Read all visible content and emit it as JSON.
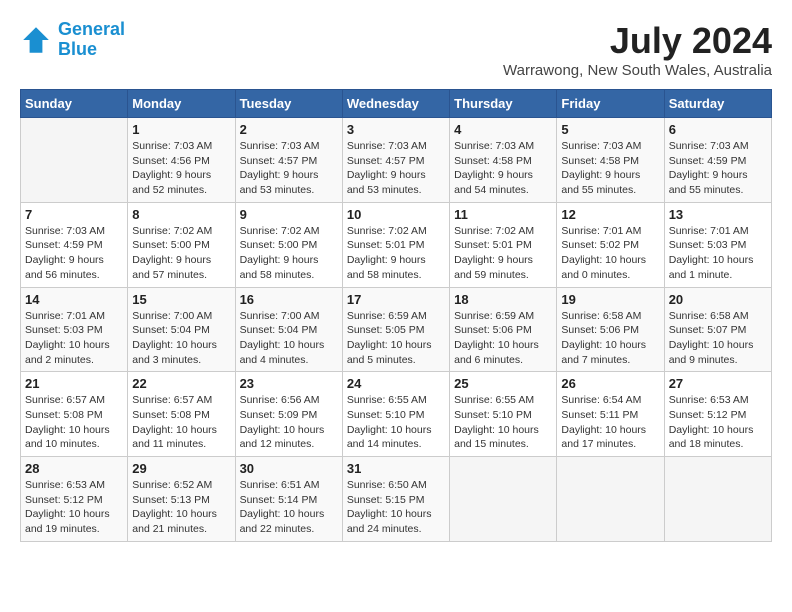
{
  "header": {
    "logo_line1": "General",
    "logo_line2": "Blue",
    "month_title": "July 2024",
    "location": "Warrawong, New South Wales, Australia"
  },
  "days_of_week": [
    "Sunday",
    "Monday",
    "Tuesday",
    "Wednesday",
    "Thursday",
    "Friday",
    "Saturday"
  ],
  "weeks": [
    [
      {
        "day": "",
        "info": ""
      },
      {
        "day": "1",
        "info": "Sunrise: 7:03 AM\nSunset: 4:56 PM\nDaylight: 9 hours\nand 52 minutes."
      },
      {
        "day": "2",
        "info": "Sunrise: 7:03 AM\nSunset: 4:57 PM\nDaylight: 9 hours\nand 53 minutes."
      },
      {
        "day": "3",
        "info": "Sunrise: 7:03 AM\nSunset: 4:57 PM\nDaylight: 9 hours\nand 53 minutes."
      },
      {
        "day": "4",
        "info": "Sunrise: 7:03 AM\nSunset: 4:58 PM\nDaylight: 9 hours\nand 54 minutes."
      },
      {
        "day": "5",
        "info": "Sunrise: 7:03 AM\nSunset: 4:58 PM\nDaylight: 9 hours\nand 55 minutes."
      },
      {
        "day": "6",
        "info": "Sunrise: 7:03 AM\nSunset: 4:59 PM\nDaylight: 9 hours\nand 55 minutes."
      }
    ],
    [
      {
        "day": "7",
        "info": "Sunrise: 7:03 AM\nSunset: 4:59 PM\nDaylight: 9 hours\nand 56 minutes."
      },
      {
        "day": "8",
        "info": "Sunrise: 7:02 AM\nSunset: 5:00 PM\nDaylight: 9 hours\nand 57 minutes."
      },
      {
        "day": "9",
        "info": "Sunrise: 7:02 AM\nSunset: 5:00 PM\nDaylight: 9 hours\nand 58 minutes."
      },
      {
        "day": "10",
        "info": "Sunrise: 7:02 AM\nSunset: 5:01 PM\nDaylight: 9 hours\nand 58 minutes."
      },
      {
        "day": "11",
        "info": "Sunrise: 7:02 AM\nSunset: 5:01 PM\nDaylight: 9 hours\nand 59 minutes."
      },
      {
        "day": "12",
        "info": "Sunrise: 7:01 AM\nSunset: 5:02 PM\nDaylight: 10 hours\nand 0 minutes."
      },
      {
        "day": "13",
        "info": "Sunrise: 7:01 AM\nSunset: 5:03 PM\nDaylight: 10 hours\nand 1 minute."
      }
    ],
    [
      {
        "day": "14",
        "info": "Sunrise: 7:01 AM\nSunset: 5:03 PM\nDaylight: 10 hours\nand 2 minutes."
      },
      {
        "day": "15",
        "info": "Sunrise: 7:00 AM\nSunset: 5:04 PM\nDaylight: 10 hours\nand 3 minutes."
      },
      {
        "day": "16",
        "info": "Sunrise: 7:00 AM\nSunset: 5:04 PM\nDaylight: 10 hours\nand 4 minutes."
      },
      {
        "day": "17",
        "info": "Sunrise: 6:59 AM\nSunset: 5:05 PM\nDaylight: 10 hours\nand 5 minutes."
      },
      {
        "day": "18",
        "info": "Sunrise: 6:59 AM\nSunset: 5:06 PM\nDaylight: 10 hours\nand 6 minutes."
      },
      {
        "day": "19",
        "info": "Sunrise: 6:58 AM\nSunset: 5:06 PM\nDaylight: 10 hours\nand 7 minutes."
      },
      {
        "day": "20",
        "info": "Sunrise: 6:58 AM\nSunset: 5:07 PM\nDaylight: 10 hours\nand 9 minutes."
      }
    ],
    [
      {
        "day": "21",
        "info": "Sunrise: 6:57 AM\nSunset: 5:08 PM\nDaylight: 10 hours\nand 10 minutes."
      },
      {
        "day": "22",
        "info": "Sunrise: 6:57 AM\nSunset: 5:08 PM\nDaylight: 10 hours\nand 11 minutes."
      },
      {
        "day": "23",
        "info": "Sunrise: 6:56 AM\nSunset: 5:09 PM\nDaylight: 10 hours\nand 12 minutes."
      },
      {
        "day": "24",
        "info": "Sunrise: 6:55 AM\nSunset: 5:10 PM\nDaylight: 10 hours\nand 14 minutes."
      },
      {
        "day": "25",
        "info": "Sunrise: 6:55 AM\nSunset: 5:10 PM\nDaylight: 10 hours\nand 15 minutes."
      },
      {
        "day": "26",
        "info": "Sunrise: 6:54 AM\nSunset: 5:11 PM\nDaylight: 10 hours\nand 17 minutes."
      },
      {
        "day": "27",
        "info": "Sunrise: 6:53 AM\nSunset: 5:12 PM\nDaylight: 10 hours\nand 18 minutes."
      }
    ],
    [
      {
        "day": "28",
        "info": "Sunrise: 6:53 AM\nSunset: 5:12 PM\nDaylight: 10 hours\nand 19 minutes."
      },
      {
        "day": "29",
        "info": "Sunrise: 6:52 AM\nSunset: 5:13 PM\nDaylight: 10 hours\nand 21 minutes."
      },
      {
        "day": "30",
        "info": "Sunrise: 6:51 AM\nSunset: 5:14 PM\nDaylight: 10 hours\nand 22 minutes."
      },
      {
        "day": "31",
        "info": "Sunrise: 6:50 AM\nSunset: 5:15 PM\nDaylight: 10 hours\nand 24 minutes."
      },
      {
        "day": "",
        "info": ""
      },
      {
        "day": "",
        "info": ""
      },
      {
        "day": "",
        "info": ""
      }
    ]
  ]
}
